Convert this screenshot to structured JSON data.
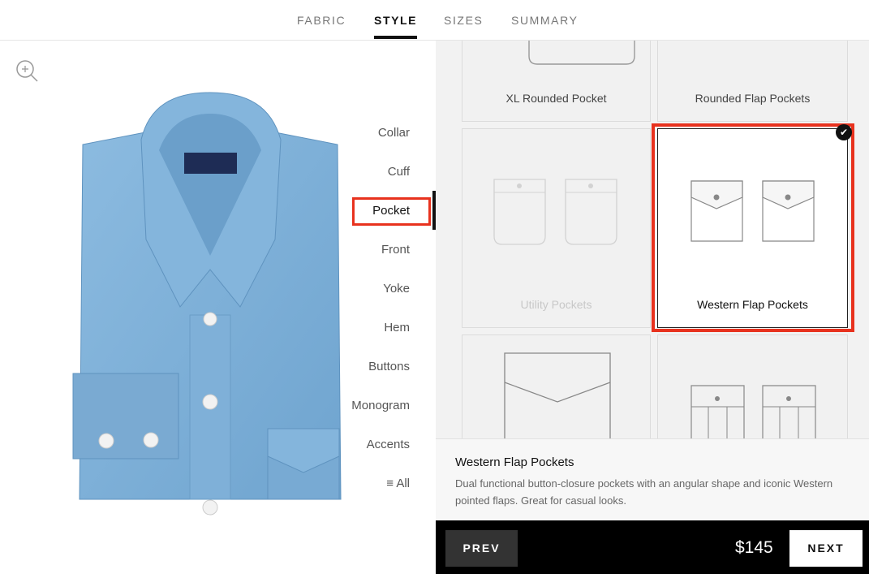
{
  "tabs": [
    {
      "label": "FABRIC"
    },
    {
      "label": "STYLE"
    },
    {
      "label": "SIZES"
    },
    {
      "label": "SUMMARY"
    }
  ],
  "menu": {
    "items": [
      {
        "label": "Collar"
      },
      {
        "label": "Cuff"
      },
      {
        "label": "Pocket"
      },
      {
        "label": "Front"
      },
      {
        "label": "Yoke"
      },
      {
        "label": "Hem"
      },
      {
        "label": "Buttons"
      },
      {
        "label": "Monogram"
      },
      {
        "label": "Accents"
      },
      {
        "label": "≡ All"
      }
    ],
    "active": "Pocket"
  },
  "shirt": {
    "label_text": "PROPER CLOTH",
    "icon": "shirt-image"
  },
  "options": [
    {
      "label": "XL Rounded Pocket"
    },
    {
      "label": "Rounded Flap Pockets"
    },
    {
      "label": "Utility Pockets"
    },
    {
      "label": "Western Flap Pockets",
      "selected": true
    }
  ],
  "description": {
    "title": "Western Flap Pockets",
    "text": "Dual functional button-closure pockets with an angular shape and iconic Western pointed flaps. Great for casual looks."
  },
  "footer": {
    "prev": "PREV",
    "price": "$145",
    "next": "NEXT"
  },
  "colors": {
    "accent": "#e8321e",
    "shirt": "#7fb0d8"
  }
}
